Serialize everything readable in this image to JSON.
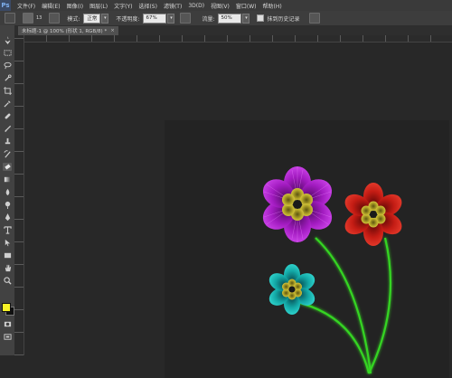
{
  "app": {
    "logo": "Ps"
  },
  "menu": {
    "items": [
      "文件(F)",
      "编辑(E)",
      "图像(I)",
      "图层(L)",
      "文字(Y)",
      "选择(S)",
      "滤镜(T)",
      "3D(D)",
      "视图(V)",
      "窗口(W)",
      "帮助(H)"
    ]
  },
  "options": {
    "brush_size": "13",
    "mode_label": "模式:",
    "mode_value": "正常",
    "opacity_label": "不透明度:",
    "opacity_value": "67%",
    "flow_label": "流量:",
    "flow_value": "50%",
    "history_label": "抹到历史记录"
  },
  "document": {
    "tab_title": "未标题-1 @ 100% (形状 1, RGB/8) *",
    "close_glyph": "×"
  },
  "tools": [
    "move-tool",
    "marquee-tool",
    "lasso-tool",
    "quick-select-tool",
    "crop-tool",
    "eyedropper-tool",
    "healing-tool",
    "brush-tool",
    "stamp-tool",
    "history-brush-tool",
    "eraser-tool",
    "gradient-tool",
    "blur-tool",
    "dodge-tool",
    "pen-tool",
    "type-tool",
    "path-select-tool",
    "shape-tool",
    "hand-tool",
    "zoom-tool"
  ],
  "colors": {
    "foreground": "#f7f226",
    "background": "#111111",
    "canvas": "#232323",
    "purple_flower": "#b21fd0",
    "red_flower": "#d4241c",
    "teal_flower": "#16b8b4",
    "flower_center": "#d6c83a",
    "stem": "#32d322"
  }
}
